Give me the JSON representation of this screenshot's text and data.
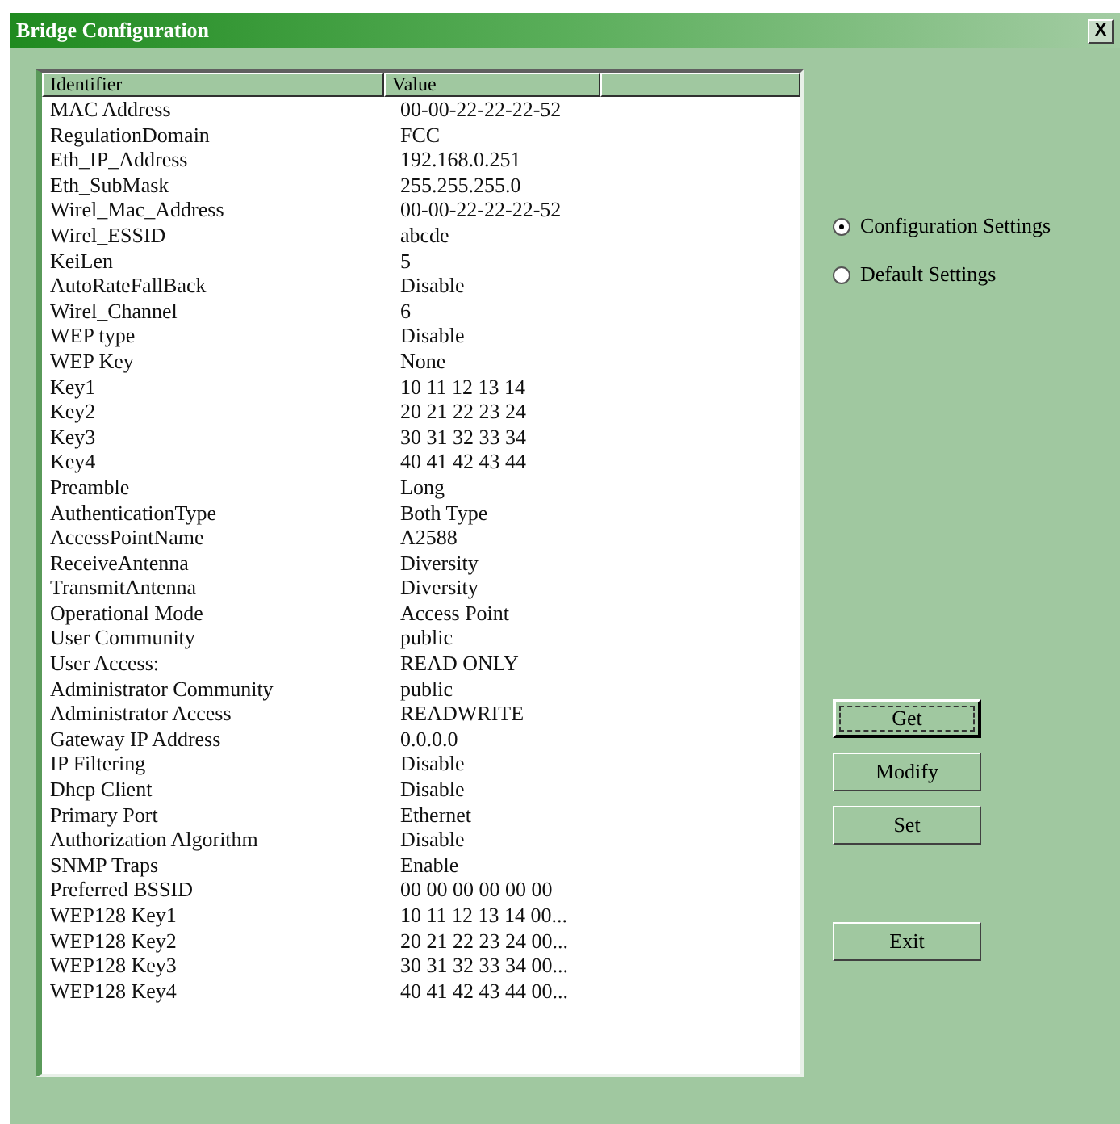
{
  "window": {
    "title": "Bridge Configuration",
    "close": "X"
  },
  "table": {
    "columns": [
      "Identifier",
      "Value"
    ],
    "rows": [
      {
        "identifier": "MAC Address",
        "value": "00-00-22-22-22-52"
      },
      {
        "identifier": "RegulationDomain",
        "value": "FCC"
      },
      {
        "identifier": "Eth_IP_Address",
        "value": "192.168.0.251"
      },
      {
        "identifier": "Eth_SubMask",
        "value": "255.255.255.0"
      },
      {
        "identifier": "Wirel_Mac_Address",
        "value": "00-00-22-22-22-52"
      },
      {
        "identifier": "Wirel_ESSID",
        "value": "abcde"
      },
      {
        "identifier": "KeiLen",
        "value": "5"
      },
      {
        "identifier": "AutoRateFallBack",
        "value": "Disable"
      },
      {
        "identifier": "Wirel_Channel",
        "value": "6"
      },
      {
        "identifier": "WEP type",
        "value": "Disable"
      },
      {
        "identifier": "WEP Key",
        "value": "None"
      },
      {
        "identifier": "Key1",
        "value": "10 11 12 13 14"
      },
      {
        "identifier": "Key2",
        "value": "20 21 22 23 24"
      },
      {
        "identifier": "Key3",
        "value": "30 31 32 33 34"
      },
      {
        "identifier": "Key4",
        "value": "40 41 42 43 44"
      },
      {
        "identifier": "Preamble",
        "value": "Long"
      },
      {
        "identifier": "AuthenticationType",
        "value": "Both Type"
      },
      {
        "identifier": "AccessPointName",
        "value": "A2588"
      },
      {
        "identifier": "ReceiveAntenna",
        "value": "Diversity"
      },
      {
        "identifier": "TransmitAntenna",
        "value": "Diversity"
      },
      {
        "identifier": "Operational Mode",
        "value": "Access Point"
      },
      {
        "identifier": "User Community",
        "value": "public"
      },
      {
        "identifier": "User Access:",
        "value": "READ ONLY"
      },
      {
        "identifier": "Administrator Community",
        "value": "public"
      },
      {
        "identifier": "Administrator Access",
        "value": "READWRITE"
      },
      {
        "identifier": "Gateway IP Address",
        "value": "0.0.0.0"
      },
      {
        "identifier": "IP Filtering",
        "value": "Disable"
      },
      {
        "identifier": "Dhcp Client",
        "value": "Disable"
      },
      {
        "identifier": "Primary Port",
        "value": "Ethernet"
      },
      {
        "identifier": "Authorization Algorithm",
        "value": "Disable"
      },
      {
        "identifier": "SNMP Traps",
        "value": "Enable"
      },
      {
        "identifier": "Preferred BSSID",
        "value": "00 00 00 00 00 00"
      },
      {
        "identifier": "WEP128 Key1",
        "value": "10 11 12 13 14 00..."
      },
      {
        "identifier": "WEP128 Key2",
        "value": "20 21 22 23 24 00..."
      },
      {
        "identifier": "WEP128 Key3",
        "value": "30 31 32 33 34 00..."
      },
      {
        "identifier": "WEP128 Key4",
        "value": "40 41 42 43 44 00..."
      }
    ]
  },
  "settings": [
    {
      "label": "Configuration Settings",
      "selected": true
    },
    {
      "label": "Default Settings",
      "selected": false
    }
  ],
  "buttons": [
    {
      "label": "Get",
      "focused": true
    },
    {
      "label": "Modify",
      "focused": false
    },
    {
      "label": "Set",
      "focused": false
    },
    {
      "label": "Exit",
      "focused": false
    }
  ]
}
